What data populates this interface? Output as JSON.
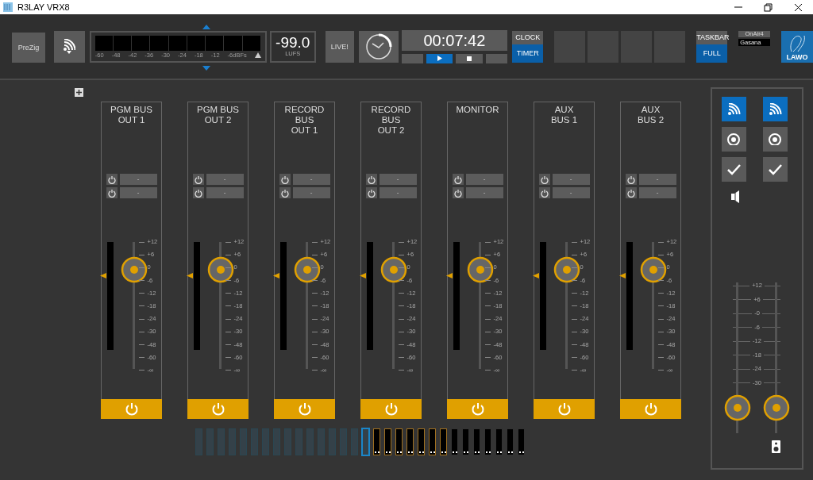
{
  "window": {
    "title": "R3LAY VRX8"
  },
  "toolbar": {
    "prezig": "PreZig",
    "meter_scale": [
      "-60",
      "-48",
      "-42",
      "-36",
      "-30",
      "-24",
      "-18",
      "-12",
      "-6dBFs"
    ],
    "loudness": {
      "value": "-99.0",
      "unit": "LUFS"
    },
    "live": "LIVE!",
    "timer": "00:07:42",
    "transport": [
      {
        "kind": "blank",
        "selected": false
      },
      {
        "kind": "play",
        "selected": true
      },
      {
        "kind": "stop",
        "selected": false
      },
      {
        "kind": "blank",
        "selected": false
      }
    ],
    "mode_buttons": [
      {
        "label": "CLOCK",
        "selected": false
      },
      {
        "label": "TIMER",
        "selected": true
      }
    ],
    "taskbar_buttons": [
      {
        "label": "TASKBAR",
        "selected": false
      },
      {
        "label": "FULL",
        "selected": true
      }
    ],
    "onair": {
      "label": "OnAir4",
      "value": "Gasana"
    },
    "logo": "LAWO"
  },
  "channels": [
    {
      "name": [
        "PGM BUS",
        "OUT 1"
      ],
      "routes": [
        "-",
        "-"
      ],
      "level": 0.78,
      "on": true,
      "scale": [
        "+12",
        "+6",
        "0",
        "-6",
        "-12",
        "-18",
        "-24",
        "-30",
        "-48",
        "-60",
        "-∞"
      ]
    },
    {
      "name": [
        "PGM BUS",
        "OUT 2"
      ],
      "routes": [
        "-",
        "-"
      ],
      "level": 0.78,
      "on": true,
      "scale": [
        "+12",
        "+6",
        "0",
        "-6",
        "-12",
        "-18",
        "-24",
        "-30",
        "-48",
        "-60",
        "-∞"
      ]
    },
    {
      "name": [
        "RECORD BUS",
        "OUT 1"
      ],
      "routes": [
        "-",
        "-"
      ],
      "level": 0.78,
      "on": true,
      "scale": [
        "+12",
        "+6",
        "0",
        "-6",
        "-12",
        "-18",
        "-24",
        "-30",
        "-48",
        "-60",
        "-∞"
      ]
    },
    {
      "name": [
        "RECORD BUS",
        "OUT 2"
      ],
      "routes": [
        "-",
        "-"
      ],
      "level": 0.78,
      "on": true,
      "scale": [
        "+12",
        "+6",
        "0",
        "-6",
        "-12",
        "-18",
        "-24",
        "-30",
        "-48",
        "-60",
        "-∞"
      ]
    },
    {
      "name": [
        "MONITOR"
      ],
      "routes": [
        "-",
        "-"
      ],
      "level": 0.78,
      "on": true,
      "scale": [
        "+12",
        "+6",
        "0",
        "-6",
        "-12",
        "-18",
        "-24",
        "-30",
        "-48",
        "-60",
        "-∞"
      ]
    },
    {
      "name": [
        "AUX",
        "BUS 1"
      ],
      "routes": [
        "-",
        "-"
      ],
      "level": 0.78,
      "on": true,
      "scale": [
        "+12",
        "+6",
        "0",
        "-6",
        "-12",
        "-18",
        "-24",
        "-30",
        "-48",
        "-60",
        "-∞"
      ]
    },
    {
      "name": [
        "AUX",
        "BUS 2"
      ],
      "routes": [
        "-",
        "-"
      ],
      "level": 0.78,
      "on": true,
      "scale": [
        "+12",
        "+6",
        "0",
        "-6",
        "-12",
        "-18",
        "-24",
        "-30",
        "-48",
        "-60",
        "-∞"
      ]
    }
  ],
  "monitor_panel": {
    "scale": [
      "+12",
      "+6",
      "-0",
      "-6",
      "-12",
      "-18",
      "-24",
      "-30"
    ],
    "columns": [
      {
        "buttons": [
          {
            "kind": "wifi",
            "selected": true
          },
          {
            "kind": "target",
            "selected": false
          },
          {
            "kind": "check",
            "selected": false
          }
        ],
        "level": 0.17
      },
      {
        "buttons": [
          {
            "kind": "wifi",
            "selected": true
          },
          {
            "kind": "target",
            "selected": false
          },
          {
            "kind": "check",
            "selected": false
          }
        ],
        "level": 0.17
      }
    ]
  },
  "slots": [
    {
      "kind": "empty",
      "selected": false,
      "grouped": false
    },
    {
      "kind": "empty",
      "selected": false,
      "grouped": false
    },
    {
      "kind": "empty",
      "selected": false,
      "grouped": false
    },
    {
      "kind": "empty",
      "selected": false,
      "grouped": false
    },
    {
      "kind": "empty",
      "selected": false,
      "grouped": false
    },
    {
      "kind": "empty",
      "selected": false,
      "grouped": false
    },
    {
      "kind": "empty",
      "selected": false,
      "grouped": false
    },
    {
      "kind": "empty",
      "selected": false,
      "grouped": false
    },
    {
      "kind": "empty",
      "selected": false,
      "grouped": false
    },
    {
      "kind": "empty",
      "selected": false,
      "grouped": false
    },
    {
      "kind": "empty",
      "selected": false,
      "grouped": false
    },
    {
      "kind": "empty",
      "selected": false,
      "grouped": false
    },
    {
      "kind": "empty",
      "selected": false,
      "grouped": false
    },
    {
      "kind": "empty",
      "selected": false,
      "grouped": false
    },
    {
      "kind": "empty",
      "selected": false,
      "grouped": false
    },
    {
      "kind": "empty",
      "selected": true,
      "grouped": false
    },
    {
      "kind": "meter",
      "selected": false,
      "grouped": true
    },
    {
      "kind": "meter",
      "selected": false,
      "grouped": true
    },
    {
      "kind": "meter",
      "selected": false,
      "grouped": true
    },
    {
      "kind": "meter",
      "selected": false,
      "grouped": true
    },
    {
      "kind": "meter",
      "selected": false,
      "grouped": true
    },
    {
      "kind": "meter",
      "selected": false,
      "grouped": true
    },
    {
      "kind": "meter",
      "selected": false,
      "grouped": true
    },
    {
      "kind": "meter",
      "selected": false,
      "grouped": false
    },
    {
      "kind": "meter",
      "selected": false,
      "grouped": false
    },
    {
      "kind": "meter",
      "selected": false,
      "grouped": false
    },
    {
      "kind": "meter",
      "selected": false,
      "grouped": false
    },
    {
      "kind": "meter",
      "selected": false,
      "grouped": false
    },
    {
      "kind": "meter",
      "selected": false,
      "grouped": false
    },
    {
      "kind": "meter",
      "selected": false,
      "grouped": false
    }
  ]
}
